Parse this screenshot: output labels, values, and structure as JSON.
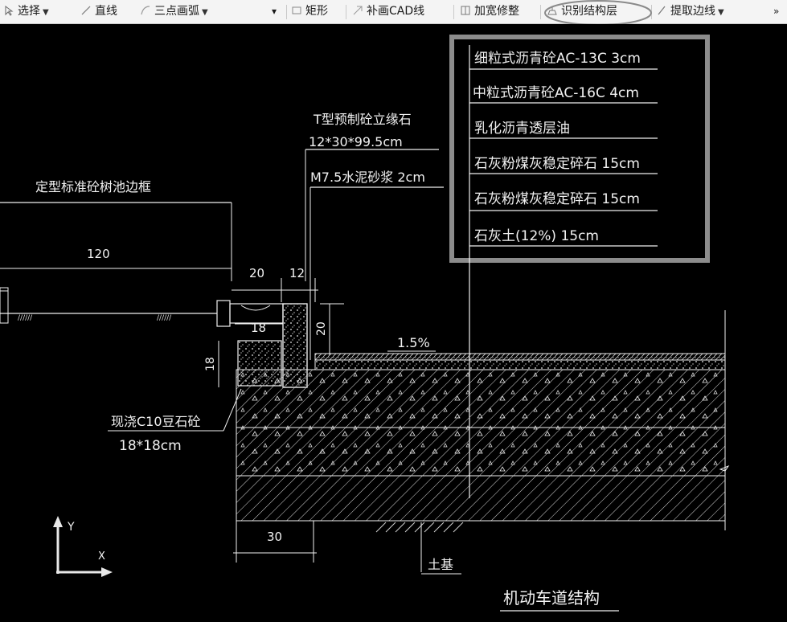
{
  "toolbar": {
    "select": "选择",
    "line": "直线",
    "arc": "三点画弧",
    "rect": "矩形",
    "redraw": "补画CAD线",
    "widen": "加宽修整",
    "identify": "识别结构层",
    "extract": "提取边线",
    "overflow": "»"
  },
  "drawing": {
    "layers": {
      "l1": "细粒式沥青砼AC-13C 3cm",
      "l2": "中粒式沥青砼AC-16C 4cm",
      "l3": "乳化沥青透层油",
      "l4": "石灰粉煤灰稳定碎石 15cm",
      "l5": "石灰粉煤灰稳定碎石 15cm",
      "l6": "石灰土(12%)  15cm"
    },
    "curb_name": "T型预制砼立缘石",
    "curb_size": "12*30*99.5cm",
    "mortar": "M7.5水泥砂浆 2cm",
    "tree_pit": "定型标准砼树池边框",
    "dim_120": "120",
    "dim_20a": "20",
    "dim_12": "12",
    "dim_18": "18",
    "dim_20b": "20",
    "dim_18v": "18",
    "dim_30": "30",
    "slope": "1.5%",
    "concrete": "现浇C10豆石砼",
    "concrete_size": "18*18cm",
    "subgrade": "土基",
    "title": "机动车道结构",
    "axis_y": "Y",
    "axis_x": "X"
  }
}
